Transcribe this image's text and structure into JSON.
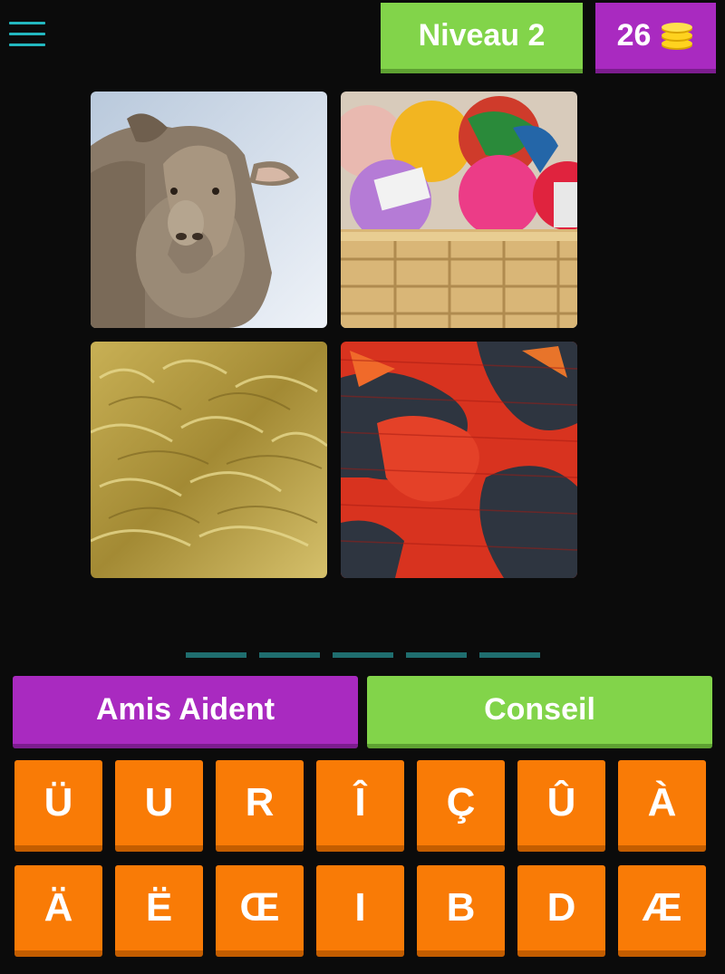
{
  "header": {
    "menu_icon": "hamburger-menu-icon",
    "level_label": "Niveau 2",
    "coins": "26",
    "coin_icon": "coin-stack-icon"
  },
  "images": [
    {
      "subject": "sheep"
    },
    {
      "subject": "yarn-balls-basket"
    },
    {
      "subject": "fleece-fur"
    },
    {
      "subject": "knitted-fabric"
    }
  ],
  "answer_slots": 5,
  "buttons": {
    "friends": "Amis Aident",
    "hint": "Conseil"
  },
  "letters": [
    "Ü",
    "U",
    "R",
    "Î",
    "Ç",
    "Û",
    "À",
    "Ä",
    "Ë",
    "Œ",
    "I",
    "B",
    "D",
    "Æ"
  ],
  "colors": {
    "level_badge": "#82d44a",
    "coin_badge": "#a92ac0",
    "key": "#f97b06",
    "slot": "#1f6e6f",
    "menu": "#23b8c0"
  }
}
